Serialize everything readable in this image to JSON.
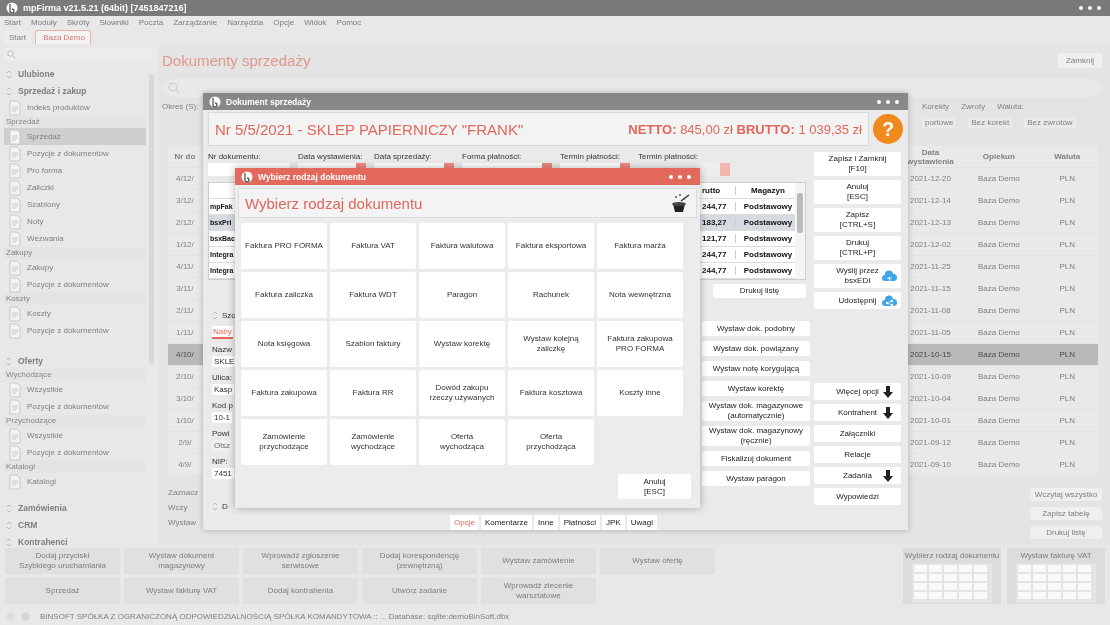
{
  "window": {
    "title": "mpFirma v21.5.21 (64bit) [7451847216]",
    "menu": [
      "Start",
      "Moduły",
      "Skróty",
      "Słowniki",
      "Poczta",
      "Zarządzanie",
      "Narzędzia",
      "Opcje",
      "Widok",
      "Pomoc"
    ],
    "tabs": [
      {
        "label": "Start",
        "selected": false
      },
      {
        "label": ":Baza Demo",
        "selected": true
      }
    ]
  },
  "sidebar": {
    "entries": [
      {
        "kind": "header",
        "label": "Ulubione"
      },
      {
        "kind": "header",
        "label": "Sprzedaż i zakup"
      },
      {
        "kind": "item",
        "label": "Indeks produktów",
        "selected": false
      },
      {
        "kind": "group",
        "label": "Sprzedaż"
      },
      {
        "kind": "item",
        "label": "Sprzedaż",
        "selected": true
      },
      {
        "kind": "item",
        "label": "Pozycje z dokumentów",
        "selected": false
      },
      {
        "kind": "item",
        "label": "Pro forma",
        "selected": false
      },
      {
        "kind": "item",
        "label": "Zaliczki",
        "selected": false
      },
      {
        "kind": "item",
        "label": "Szablony",
        "selected": false
      },
      {
        "kind": "item",
        "label": "Noty",
        "selected": false
      },
      {
        "kind": "item",
        "label": "Wezwania",
        "selected": false
      },
      {
        "kind": "group",
        "label": "Zakupy"
      },
      {
        "kind": "item",
        "label": "Zakupy",
        "selected": false
      },
      {
        "kind": "item",
        "label": "Pozycje z dokumentów",
        "selected": false
      },
      {
        "kind": "group",
        "label": "Koszty"
      },
      {
        "kind": "item",
        "label": "Koszty",
        "selected": false
      },
      {
        "kind": "item",
        "label": "Pozycje z dokumentów",
        "selected": false
      },
      {
        "kind": "header",
        "label": "Oferty"
      },
      {
        "kind": "group",
        "label": "Wychodzące"
      },
      {
        "kind": "item",
        "label": "Wszystkie",
        "selected": false
      },
      {
        "kind": "item",
        "label": "Pozycje z dokumentów",
        "selected": false
      },
      {
        "kind": "group",
        "label": "Przychodzące"
      },
      {
        "kind": "item",
        "label": "Wszystkie",
        "selected": false
      },
      {
        "kind": "item",
        "label": "Pozycje z dokumentów",
        "selected": false
      },
      {
        "kind": "group",
        "label": "Katalogi"
      },
      {
        "kind": "item",
        "label": "Katalogi",
        "selected": false
      },
      {
        "kind": "header",
        "label": "Zamówienia"
      },
      {
        "kind": "header",
        "label": "CRM"
      },
      {
        "kind": "header",
        "label": "Kontrahenci"
      }
    ]
  },
  "main": {
    "title": "Dokumenty sprzedaży",
    "close_button": "Zamknij",
    "period_label": "Okres (S):",
    "filters": {
      "top": [
        "Korekty",
        "Zwroty",
        "Waluta:"
      ],
      "bottom": [
        "portowe",
        "Bez korekt",
        "Bez zwrotów"
      ]
    },
    "table": {
      "first_column": "Nr do",
      "columns": [
        "Data wystawienia",
        "Opiekun",
        "Waluta"
      ],
      "rows": [
        {
          "column_1": "4/12/",
          "cells": [
            "2021-12-20",
            "Baza Demo",
            "PLN"
          ],
          "selected": false
        },
        {
          "column_1": "3/12/",
          "cells": [
            "2021-12-14",
            "Baza Demo",
            "PLN"
          ],
          "selected": false
        },
        {
          "column_1": "2/12/",
          "cells": [
            "2021-12-13",
            "Baza Demo",
            "PLN"
          ],
          "selected": false
        },
        {
          "column_1": "1/12/",
          "cells": [
            "2021-12-02",
            "Baza Demo",
            "PLN"
          ],
          "selected": false
        },
        {
          "column_1": "4/11/",
          "cells": [
            "2021-11-25",
            "Baza Demo",
            "PLN"
          ],
          "selected": false
        },
        {
          "column_1": "3/11/",
          "cells": [
            "2021-11-15",
            "Baza Demo",
            "PLN"
          ],
          "selected": false
        },
        {
          "column_1": "2/11/",
          "cells": [
            "2021-11-08",
            "Baza Demo",
            "PLN"
          ],
          "selected": false
        },
        {
          "column_1": "1/11/",
          "cells": [
            "2021-11-05",
            "Baza Demo",
            "PLN"
          ],
          "selected": false
        },
        {
          "column_1": "4/10/",
          "cells": [
            "2021-10-15",
            "Baza Demo",
            "PLN"
          ],
          "selected": true
        },
        {
          "column_1": "2/10/",
          "cells": [
            "2021-10-09",
            "Baza Demo",
            "PLN"
          ],
          "selected": false
        },
        {
          "column_1": "3/10/",
          "cells": [
            "2021-10-04",
            "Baza Demo",
            "PLN"
          ],
          "selected": false
        },
        {
          "column_1": "1/10/",
          "cells": [
            "2021-10-01",
            "Baza Demo",
            "PLN"
          ],
          "selected": false
        },
        {
          "column_1": "2/9/",
          "cells": [
            "2021-09-12",
            "Baza Demo",
            "PLN"
          ],
          "selected": false
        },
        {
          "column_1": "4/9/",
          "cells": [
            "2021-09-10",
            "Baza Demo",
            "PLN"
          ],
          "selected": false
        }
      ]
    },
    "bottom_left": [
      "Zaznacz",
      "Wczy",
      "Wystaw"
    ],
    "bottom_right": [
      "Wczytaj wszystko",
      "Zapisz tabelę",
      "Drukuj listę"
    ]
  },
  "quick_buttons": [
    [
      "Dodaj przyciski\nSzybkiego uruchamiania",
      "Wystaw dokument\nmagazynowy",
      "Wprowadź zgłoszenie\nserwisowe",
      "Dodaj korespondencję\n(zewnętrzną)",
      "Wystaw zamówienie",
      "Wystaw ofertę"
    ],
    [
      "Sprzedaż",
      "Wystaw fakturę VAT",
      "Dodaj kontrahenta",
      "Utwórz zadanie",
      "Wprowadź zlecenie\nwarsztatowe"
    ]
  ],
  "previews": [
    "Wybierz rodzaj dokumentu",
    "Wystaw fakturę VAT"
  ],
  "status_bar": "BINSOFT SPÓŁKA Z OGRANICZONĄ ODPOWIEDZIALNOŚCIĄ SPÓŁKA KOMANDYTOWA :: ... Database: sqlite:demoBinSoft.dbx",
  "document_window": {
    "title": "Dokument sprzedaży",
    "help_icon": "?",
    "heading": "Nr 5/5/2021 - SKLEP PAPIERNICZY \"FRANK\"",
    "totals": "**NETTO:** 845,00 zł **BRUTTO:** 1 039,35 zł",
    "fields": [
      {
        "label": "Nr dokumentu:",
        "dropdown": false,
        "disabled": false
      },
      {
        "label": "Data wystawienia:",
        "dropdown": true,
        "disabled": false
      },
      {
        "label": "Data sprzedaży:",
        "dropdown": true,
        "disabled": false
      },
      {
        "label": "Forma płatności:",
        "dropdown": true,
        "disabled": false
      },
      {
        "label": "Termin płatności:",
        "dropdown": true,
        "disabled": false
      },
      {
        "label": "Termin płatności:",
        "dropdown": true,
        "disabled": true
      }
    ],
    "items": {
      "columns": [
        "rutto",
        "Magazyn"
      ],
      "rows": [
        {
          "column_1": "mpFak",
          "cells": [
            "244,77",
            "Podstawowy"
          ],
          "selected": false
        },
        {
          "column_1": "bsxPri",
          "cells": [
            "183,27",
            "Podstawowy"
          ],
          "selected": true
        },
        {
          "column_1": "bsxBac",
          "cells": [
            "121,77",
            "Podstawowy"
          ],
          "selected": false
        },
        {
          "column_1": "Integra",
          "cells": [
            "244,77",
            "Podstawowy"
          ],
          "selected": false
        },
        {
          "column_1": "Integra",
          "cells": [
            "244,77",
            "Podstawowy"
          ],
          "selected": false
        }
      ]
    },
    "print_list": "Drukuj listę",
    "form": {
      "section": "Szc",
      "tab": {
        "label": "Naby",
        "selected": true
      },
      "fields": [
        {
          "label": "Nazw",
          "value": "SKLE",
          "disabled": false
        },
        {
          "label": "Ulica:",
          "value": "Kasp",
          "disabled": false
        },
        {
          "label": "Kod p",
          "value": "10-1",
          "disabled": false
        },
        {
          "label": "Powi",
          "value": "Olsz",
          "disabled": true
        },
        {
          "label": "NIP:",
          "value": "7451",
          "disabled": false
        }
      ],
      "section_2": "D"
    },
    "actions": [
      "Wystaw dok. podobny",
      "Wystaw dok. powiązany",
      "Wystaw notę korygującą",
      "Wystaw korektę",
      "Wystaw dok. magazynowe\n(automatycznie)",
      "Wystaw dok. magazynowy\n(ręcznie)",
      "Fiskalizuj dokument",
      "Wystaw paragon"
    ],
    "side_buttons": [
      {
        "label": "Zapisz i Zamknij\n[F10]",
        "kind": "plain"
      },
      {
        "label": "Anuluj\n[ESC]",
        "kind": "plain"
      },
      {
        "label": "Zapisz\n[CTRL+S]",
        "kind": "plain"
      },
      {
        "label": "Drukuj\n[CTRL+P]",
        "kind": "plain"
      },
      {
        "label": "Wyślij przez\nbsxEDI",
        "kind": "upload"
      },
      {
        "label": "Udostępnij",
        "kind": "share"
      },
      {
        "kind": "spacer"
      },
      {
        "label": "Więcej opcji",
        "kind": "dropdown"
      },
      {
        "label": "Kontrahent",
        "kind": "dropdown"
      },
      {
        "label": "Załączniki",
        "kind": "plain"
      },
      {
        "label": "Relacje",
        "kind": "plain"
      },
      {
        "label": "Zadania",
        "kind": "dropdown"
      },
      {
        "label": "Wypowiedzi",
        "kind": "plain"
      }
    ],
    "tabs": [
      {
        "label": "Opcje",
        "selected": true
      },
      {
        "label": "Komentarze",
        "selected": false
      },
      {
        "label": "Inne",
        "selected": false
      },
      {
        "label": "Płatności",
        "selected": false
      },
      {
        "label": "JPK",
        "selected": false
      },
      {
        "label": "Uwagi",
        "selected": false
      }
    ]
  },
  "dialog": {
    "title": "Wybierz rodzaj dokumentu",
    "heading": "Wybierz rodzaj dokumentu",
    "options": [
      "Faktura PRO FORMA",
      "Faktura VAT",
      "Faktura walutowa",
      "Faktura eksportowa",
      "Faktura marża",
      "Faktura zaliczka",
      "Faktura WDT",
      "Paragon",
      "Rachunek",
      "Nota wewnętrzna",
      "Nota księgowa",
      "Szablon faktury",
      "Wystaw korektę",
      "Wystaw kolejną\nzaliczkę",
      "Faktura zakupowa\nPRO FORMA",
      "Faktura zakupowa",
      "Faktura RR",
      "Dowód zakupu\nrzeczy używanych",
      "Faktura kosztowa",
      "Koszty inne",
      "Zamówienie\nprzychodzące",
      "Zamówienie\nwychodzące",
      "Oferta\nwychodząca",
      "Oferta\nprzychodząca"
    ],
    "cancel": "Anuluj\n[ESC]"
  }
}
